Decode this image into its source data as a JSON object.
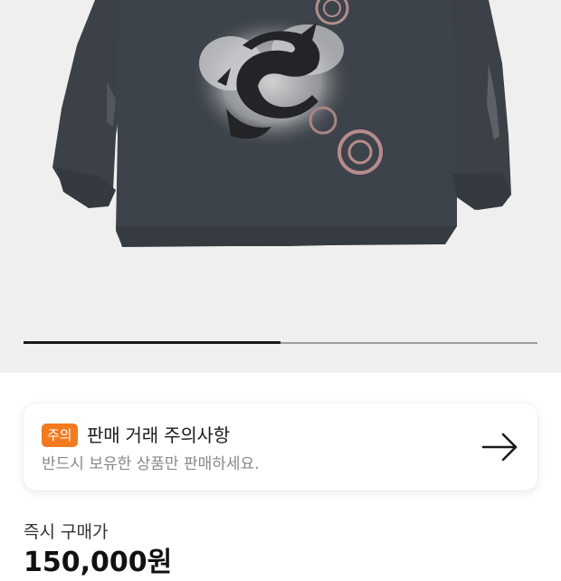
{
  "gallery": {
    "product_image": "graphic-long-sleeve-shirt",
    "progress_fraction": 0.5
  },
  "notice": {
    "badge": "주의",
    "badge_color": "#f47a20",
    "title": "판매 거래 주의사항",
    "description": "반드시 보유한 상품만 판매하세요.",
    "action_icon": "arrow-right-icon"
  },
  "price": {
    "label": "즉시 구매가",
    "value": "150,000원"
  }
}
